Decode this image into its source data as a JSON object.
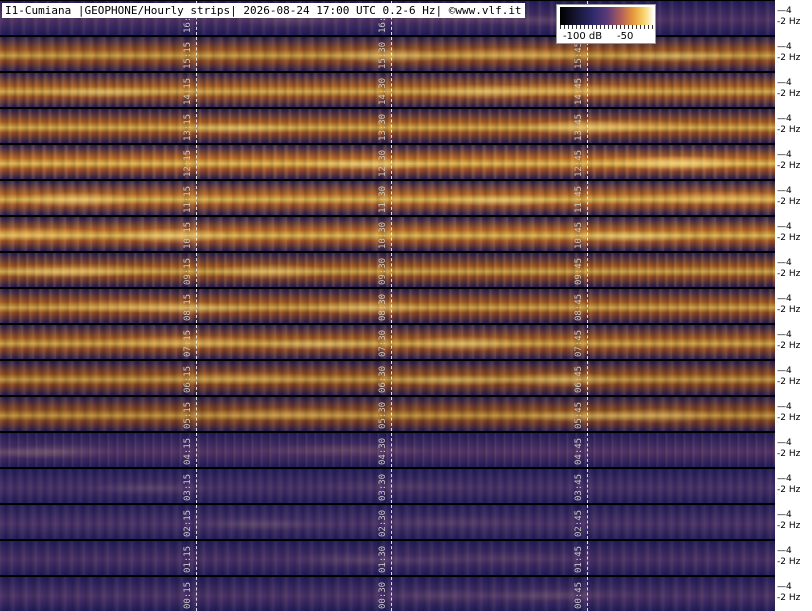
{
  "title": "I1-Cumiana |GEOPHONE/Hourly strips| 2026-08-24 17:00 UTC 0.2-6 Hz| ©www.vlf.it",
  "colorbar": {
    "label_low": "-100 dB",
    "label_high": "-50",
    "gradient": [
      "#000000",
      "#2e2a6a",
      "#5a3a7a",
      "#e89a3a",
      "#ffffff"
    ]
  },
  "axis": {
    "tick_upper": "4",
    "tick_lower": "2 Hz"
  },
  "strips": [
    {
      "labels": [
        "16:15",
        "16:30",
        "16:45"
      ],
      "intensity": 0.2
    },
    {
      "labels": [
        "15:15",
        "15:30",
        "15:45"
      ],
      "intensity": 0.62
    },
    {
      "labels": [
        "14:15",
        "14:30",
        "14:45"
      ],
      "intensity": 0.7
    },
    {
      "labels": [
        "13:15",
        "13:30",
        "13:45"
      ],
      "intensity": 0.72
    },
    {
      "labels": [
        "12:15",
        "12:30",
        "12:45"
      ],
      "intensity": 0.85
    },
    {
      "labels": [
        "11:15",
        "11:30",
        "11:45"
      ],
      "intensity": 0.78
    },
    {
      "labels": [
        "10:15",
        "10:30",
        "10:45"
      ],
      "intensity": 0.82
    },
    {
      "labels": [
        "09:15",
        "09:30",
        "09:45"
      ],
      "intensity": 0.66
    },
    {
      "labels": [
        "08:15",
        "08:30",
        "08:45"
      ],
      "intensity": 0.64
    },
    {
      "labels": [
        "07:15",
        "07:30",
        "07:45"
      ],
      "intensity": 0.68
    },
    {
      "labels": [
        "06:15",
        "06:30",
        "06:45"
      ],
      "intensity": 0.55
    },
    {
      "labels": [
        "05:15",
        "05:30",
        "05:45"
      ],
      "intensity": 0.52
    },
    {
      "labels": [
        "04:15",
        "04:30",
        "04:45"
      ],
      "intensity": 0.25
    },
    {
      "labels": [
        "03:15",
        "03:30",
        "03:45"
      ],
      "intensity": 0.12
    },
    {
      "labels": [
        "02:15",
        "02:30",
        "02:45"
      ],
      "intensity": 0.14
    },
    {
      "labels": [
        "01:15",
        "01:30",
        "01:45"
      ],
      "intensity": 0.15
    },
    {
      "labels": [
        "00:15",
        "00:30",
        "00:45"
      ],
      "intensity": 0.16
    }
  ]
}
